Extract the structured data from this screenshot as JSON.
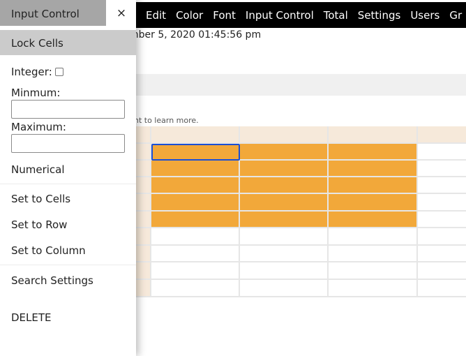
{
  "menu": [
    "Edit",
    "Color",
    "Font",
    "Input Control",
    "Total",
    "Settings",
    "Users",
    "Gr"
  ],
  "timestamp": "mber 5, 2020 01:45:56 pm",
  "hint": "ght to learn more.",
  "panel": {
    "title": "Input Control",
    "close": "×",
    "lock_cells": "Lock Cells",
    "integer_label": "Integer:",
    "integer_checked": false,
    "minimum_label": "Minmum:",
    "minimum_value": "",
    "maximum_label": "Maximum:",
    "maximum_value": "",
    "numerical": "Numerical",
    "set_cells": "Set to Cells",
    "set_row": "Set to Row",
    "set_column": "Set to Column",
    "search_settings": "Search Settings",
    "delete": "DELETE"
  },
  "colors": {
    "highlight": "#f2a83a",
    "header": "#f6e9da",
    "selection": "#1a4fd6"
  }
}
